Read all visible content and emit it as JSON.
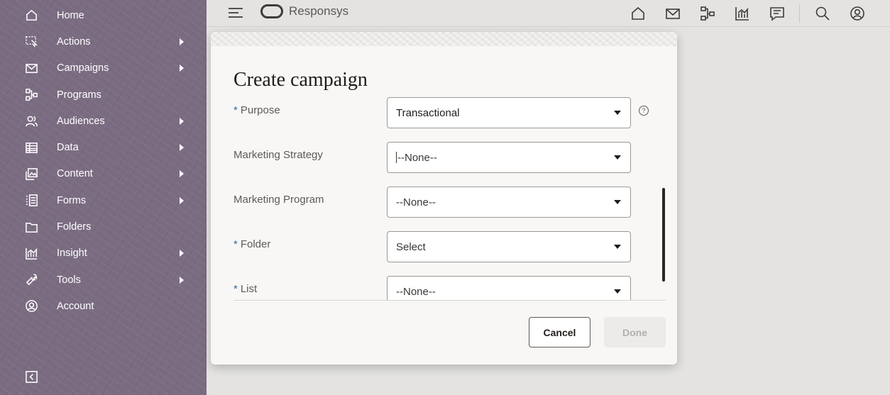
{
  "sidebar": {
    "items": [
      {
        "label": "Home",
        "icon": "home-icon",
        "submenu": false
      },
      {
        "label": "Actions",
        "icon": "actions-icon",
        "submenu": true
      },
      {
        "label": "Campaigns",
        "icon": "mail-icon",
        "submenu": true
      },
      {
        "label": "Programs",
        "icon": "programs-icon",
        "submenu": false
      },
      {
        "label": "Audiences",
        "icon": "audiences-icon",
        "submenu": true
      },
      {
        "label": "Data",
        "icon": "data-table-icon",
        "submenu": true
      },
      {
        "label": "Content",
        "icon": "content-icon",
        "submenu": true
      },
      {
        "label": "Forms",
        "icon": "forms-icon",
        "submenu": true
      },
      {
        "label": "Folders",
        "icon": "folder-icon",
        "submenu": false
      },
      {
        "label": "Insight",
        "icon": "insight-chart-icon",
        "submenu": true
      },
      {
        "label": "Tools",
        "icon": "wrench-icon",
        "submenu": true
      },
      {
        "label": "Account",
        "icon": "account-icon",
        "submenu": false
      }
    ],
    "collapse_icon": "collapse-sidebar-icon"
  },
  "header": {
    "brand": "Responsys",
    "icons": [
      "home-icon",
      "mail-icon",
      "programs-icon",
      "insight-chart-icon",
      "chat-icon",
      "search-icon",
      "user-profile-icon"
    ]
  },
  "dialog": {
    "title": "Create campaign",
    "fields": [
      {
        "label": "Purpose",
        "required": true,
        "value": "Transactional",
        "help": "?"
      },
      {
        "label": "Marketing Strategy",
        "required": false,
        "value": "--None--"
      },
      {
        "label": "Marketing Program",
        "required": false,
        "value": "--None--"
      },
      {
        "label": "Folder",
        "required": true,
        "value": "Select"
      },
      {
        "label": "List",
        "required": true,
        "value": "--None--"
      }
    ],
    "required_marker": "*",
    "cancel_label": "Cancel",
    "done_label": "Done"
  },
  "colors": {
    "sidebar_bg": "#7a6b80",
    "required_marker": "#2f6aa8",
    "dialog_bg": "#f8f7f5"
  }
}
